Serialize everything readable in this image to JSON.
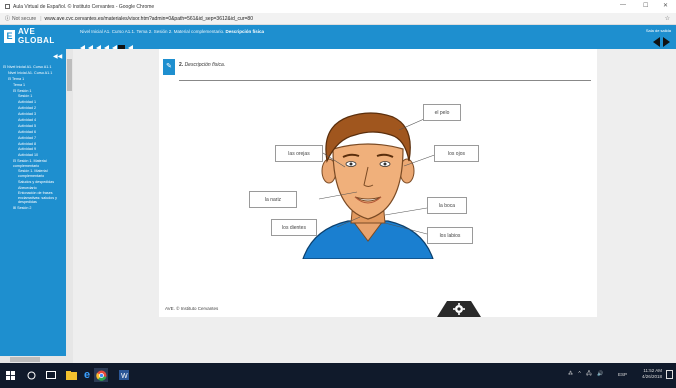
{
  "browser": {
    "tab_title": "Aula Virtual de Español. © Instituto Cervantes - Google Chrome",
    "security_label": "Not secure",
    "url": "www.ave.cvc.cervantes.es/materiales/visor.htm?admin=0&path=561&id_sep=3612&id_cur=80"
  },
  "header": {
    "logo_line1": "AVE",
    "logo_line2": "GLOBAL",
    "breadcrumb": "Nivel Inicial A1. Curso A1.1. Tema 2. Sesión 2. Material complementario. ",
    "breadcrumb_current": "Descripción física",
    "exit_label": "Sala de salida"
  },
  "sidebar": {
    "collapse_label": "◀◀",
    "items": [
      {
        "label": "⊟ Nivel Inicial A1. Curso A1.1",
        "indent": 0
      },
      {
        "label": "Nivel Inicial A1. Curso A1.1",
        "indent": 1
      },
      {
        "label": "⊟ Tema 1",
        "indent": 1
      },
      {
        "label": "Tema 1",
        "indent": 2
      },
      {
        "label": "⊟ Sesión 1",
        "indent": 2
      },
      {
        "label": "Sesión 1",
        "indent": 3
      },
      {
        "label": "Actividad 1",
        "indent": 3
      },
      {
        "label": "Actividad 2",
        "indent": 3
      },
      {
        "label": "Actividad 3",
        "indent": 3
      },
      {
        "label": "Actividad 4",
        "indent": 3
      },
      {
        "label": "Actividad 5",
        "indent": 3
      },
      {
        "label": "Actividad 6",
        "indent": 3
      },
      {
        "label": "Actividad 7",
        "indent": 3
      },
      {
        "label": "Actividad 8",
        "indent": 3
      },
      {
        "label": "Actividad 9",
        "indent": 3
      },
      {
        "label": "Actividad 10",
        "indent": 3
      },
      {
        "label": "⊟ Sesión 1. Material complementario",
        "indent": 2
      },
      {
        "label": "Sesión 1. Material complementario",
        "indent": 3
      },
      {
        "label": "Saludos y despedidas",
        "indent": 3
      },
      {
        "label": "Abecedario",
        "indent": 3
      },
      {
        "label": "Entonación de frases exclamativas: saludos y despedidas",
        "indent": 3
      },
      {
        "label": "⊞ Sesión 2",
        "indent": 2
      }
    ]
  },
  "content": {
    "title_number": "2.",
    "title_text": "Descripción física.",
    "footer": "AVE. © Instituto Cervantes",
    "labels": {
      "pelo": "el pelo",
      "orejas": "las orejas",
      "ojos": "los ojos",
      "nariz": "la nariz",
      "boca": "la boca",
      "dientes": "los dientes",
      "labios": "los labios"
    }
  },
  "taskbar": {
    "time": "11:52 AM",
    "date": "4/26/2018",
    "lang": "ESP"
  },
  "colors": {
    "accent": "#1e8fcf",
    "taskbar": "#101a2b"
  }
}
